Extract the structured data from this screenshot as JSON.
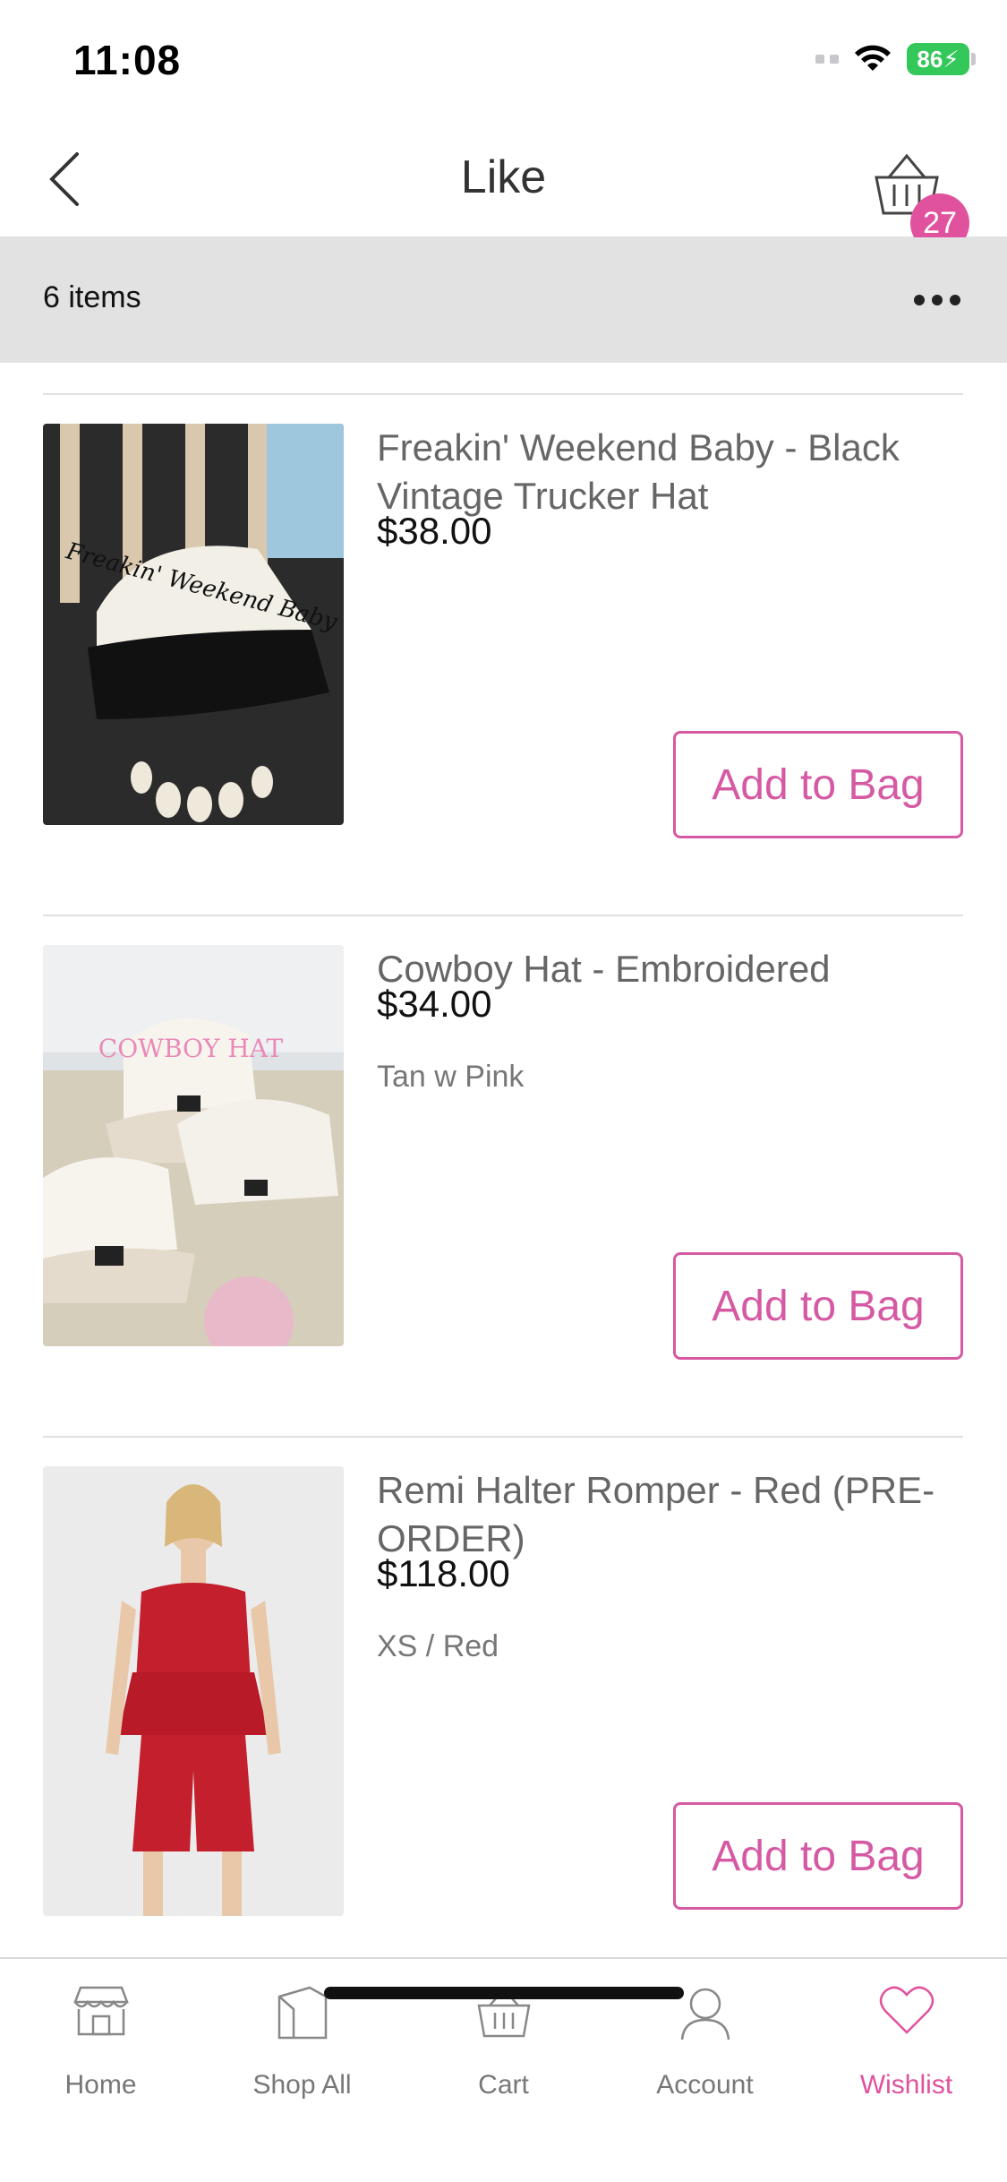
{
  "status_bar": {
    "time": "11:08",
    "battery": "86"
  },
  "nav": {
    "title": "Like",
    "cart_count": "27"
  },
  "list_header": {
    "count_label": "6 items"
  },
  "items": [
    {
      "name": "Freakin' Weekend Baby - Black Vintage Trucker Hat",
      "price": "$38.00",
      "variant": "",
      "button": "Add to Bag",
      "image_text": "Freakin' Weekend Baby"
    },
    {
      "name": "Cowboy Hat - Embroidered",
      "price": "$34.00",
      "variant": "Tan w Pink",
      "button": "Add to Bag",
      "image_text": "COWBOY HAT"
    },
    {
      "name": "Remi Halter Romper - Red (PRE-ORDER)",
      "price": "$118.00",
      "variant": "XS / Red",
      "button": "Add to Bag",
      "image_text": ""
    }
  ],
  "tabs": [
    {
      "label": "Home",
      "icon": "store-icon",
      "active": false
    },
    {
      "label": "Shop All",
      "icon": "tag-icon",
      "active": false
    },
    {
      "label": "Cart",
      "icon": "basket-icon",
      "active": false
    },
    {
      "label": "Account",
      "icon": "person-icon",
      "active": false
    },
    {
      "label": "Wishlist",
      "icon": "heart-icon",
      "active": true
    }
  ],
  "colors": {
    "accent": "#e0529e",
    "button_border": "#d55aa3",
    "header_bg": "#e2e2e2"
  }
}
